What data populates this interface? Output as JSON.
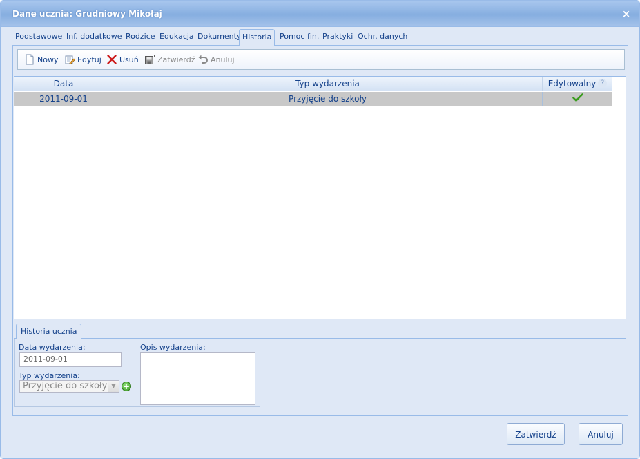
{
  "window": {
    "title": "Dane ucznia: Grudniowy Mikołaj",
    "close_symbol": "×"
  },
  "tabs": [
    {
      "label": "Podstawowe"
    },
    {
      "label": "Inf. dodatkowe"
    },
    {
      "label": "Rodzice"
    },
    {
      "label": "Edukacja"
    },
    {
      "label": "Dokumenty"
    },
    {
      "label": "Historia",
      "active": true
    },
    {
      "label": "Pomoc fin."
    },
    {
      "label": "Praktyki"
    },
    {
      "label": "Ochr. danych"
    }
  ],
  "toolbar": {
    "new_label": "Nowy",
    "edit_label": "Edytuj",
    "delete_label": "Usuń",
    "confirm_label": "Zatwierdź",
    "cancel_label": "Anuluj"
  },
  "grid": {
    "columns": [
      "Data",
      "Typ wydarzenia",
      "Edytowalny"
    ],
    "help_symbol": "?",
    "rows": [
      {
        "data": "2011-09-01",
        "typ": "Przyjęcie do szkoły",
        "edytowalny": true
      }
    ]
  },
  "detail": {
    "tab_label": "Historia ucznia",
    "date_label": "Data wydarzenia:",
    "date_value": "2011-09-01",
    "type_label": "Typ wydarzenia:",
    "type_value": "Przyjęcie do szkoły",
    "desc_label": "Opis wydarzenia:",
    "add_symbol": "+"
  },
  "footer": {
    "confirm_label": "Zatwierdź",
    "cancel_label": "Anuluj"
  },
  "colors": {
    "accent": "#15428b",
    "border": "#99bbe8",
    "panel_bg": "#dfe8f6",
    "check_green": "#3a9b1f",
    "delete_red": "#cc1a1a"
  }
}
